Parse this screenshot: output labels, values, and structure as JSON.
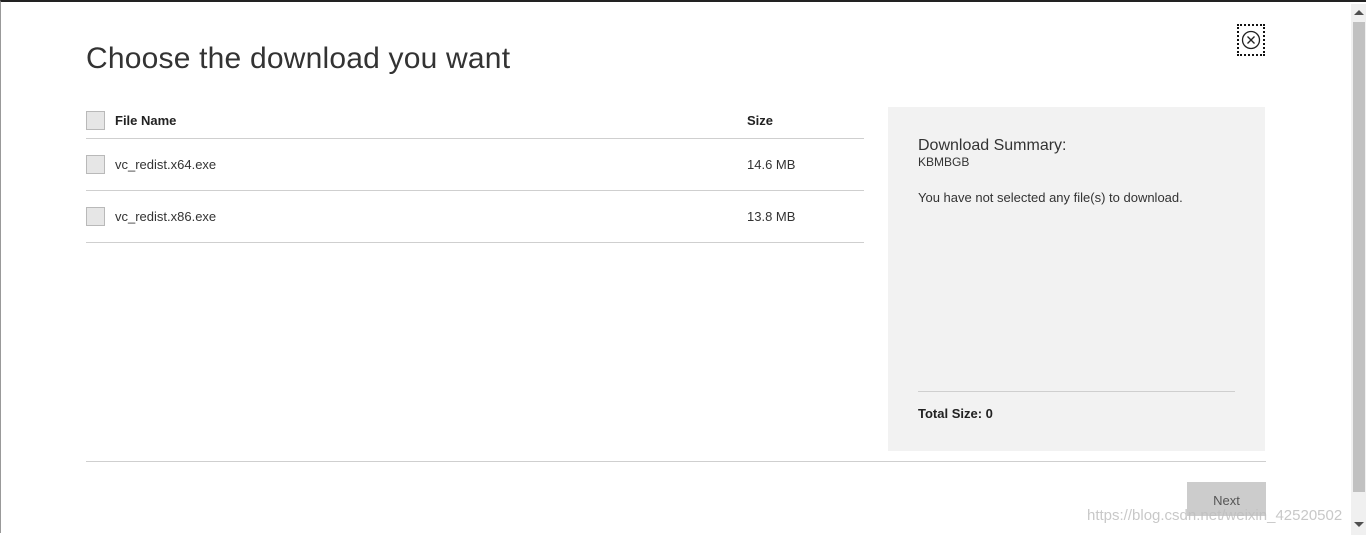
{
  "dialog": {
    "title": "Choose the download you want",
    "close_icon": "close-circle-icon"
  },
  "table": {
    "columns": [
      "File Name",
      "Size"
    ],
    "rows": [
      {
        "name": "vc_redist.x64.exe",
        "size": "14.6 MB"
      },
      {
        "name": "vc_redist.x86.exe",
        "size": "13.8 MB"
      }
    ]
  },
  "summary": {
    "title": "Download Summary:",
    "subtitle": "KBMBGB",
    "message": "You have not selected any file(s) to download.",
    "total": "Total Size: 0"
  },
  "footer": {
    "next_label": "Next"
  },
  "watermark": "https://blog.csdn.net/weixin_42520502",
  "colors": {
    "panel_bg": "#f2f2f2",
    "button_bg": "#cccccc",
    "divider": "#cfcfcf"
  }
}
